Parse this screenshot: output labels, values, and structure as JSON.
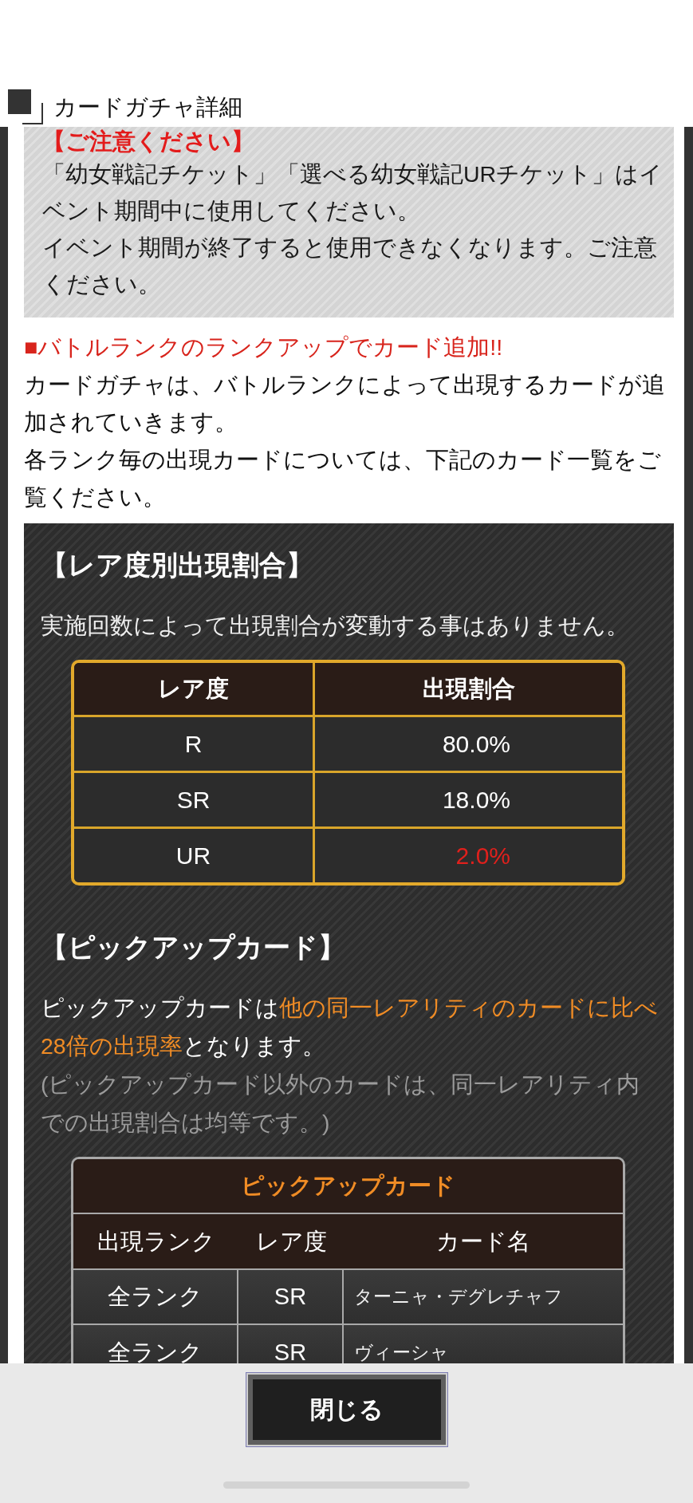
{
  "header": {
    "title": "カードガチャ詳細"
  },
  "notice": {
    "heading": "【ご注意ください】",
    "paragraphs": [
      "「幼女戦記チケット」「選べる幼女戦記URチケット」はイベント期間中に使用してください。",
      "イベント期間が終了すると使用できなくなります。ご注意ください。"
    ]
  },
  "rank_up": {
    "heading": "■バトルランクのランクアップでカード追加!!",
    "paragraphs": [
      "カードガチャは、バトルランクによって出現するカードが追加されていきます。",
      "各ランク毎の出現カードについては、下記のカード一覧をご覧ください。"
    ]
  },
  "rates": {
    "heading": "【レア度別出現割合】",
    "note": "実施回数によって出現割合が変動する事はありません。",
    "columns": [
      "レア度",
      "出現割合"
    ],
    "rows": [
      {
        "rarity": "R",
        "rate": "80.0%",
        "highlighted": false
      },
      {
        "rarity": "SR",
        "rate": "18.0%",
        "highlighted": false
      },
      {
        "rarity": "UR",
        "rate": "2.0%",
        "highlighted": true
      }
    ]
  },
  "pickup": {
    "heading": "【ピックアップカード】",
    "description": [
      {
        "text": "ピックアップカードは",
        "highlighted": false
      },
      {
        "text": "他の同一レアリティのカードに比べ28倍の出現率",
        "highlighted": true
      },
      {
        "text": "となります。",
        "highlighted": false
      }
    ],
    "note": "(ピックアップカード以外のカードは、同一レアリティ内での出現割合は均等です。)",
    "table": {
      "title": "ピックアップカード",
      "columns": [
        "出現ランク",
        "レア度",
        "カード名"
      ],
      "rows": [
        {
          "rank": "全ランク",
          "rarity": "SR",
          "card_name": "ターニャ・デグレチャフ"
        },
        {
          "rank": "全ランク",
          "rarity": "SR",
          "card_name": "ヴィーシャ"
        }
      ]
    }
  },
  "footer": {
    "close_button": "閉じる"
  }
}
